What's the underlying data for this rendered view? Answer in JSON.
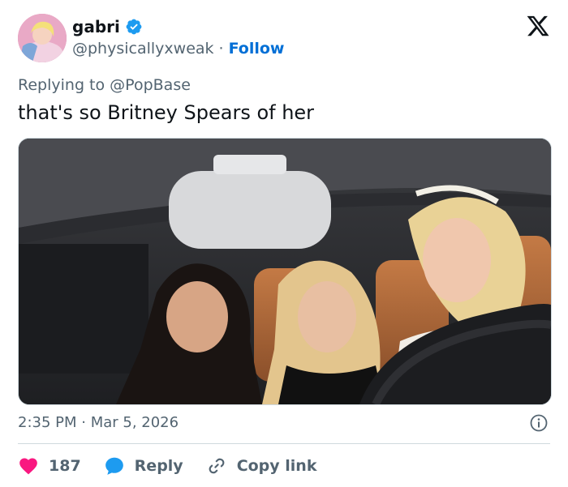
{
  "author": {
    "display_name": "gabri",
    "handle": "@physicallyxweak",
    "separator": "·",
    "follow_label": "Follow",
    "verified": true
  },
  "reply": {
    "prefix": "Replying to",
    "mention": "@PopBase"
  },
  "tweet": {
    "text": "that's so Britney Spears of her"
  },
  "meta": {
    "timestamp": "2:35 PM · Mar 5, 2026"
  },
  "actions": {
    "like_count": "187",
    "reply_label": "Reply",
    "copy_label": "Copy link"
  },
  "icons": {
    "logo": "x-logo-icon",
    "verified": "verified-badge-icon",
    "info": "info-icon",
    "like": "heart-icon",
    "reply": "reply-bubble-icon",
    "copy": "link-icon"
  },
  "colors": {
    "link_blue": "#006fd6",
    "verified_blue": "#1d9bf0",
    "like_red": "#f91880",
    "muted": "#536471",
    "text": "#0f1419"
  }
}
